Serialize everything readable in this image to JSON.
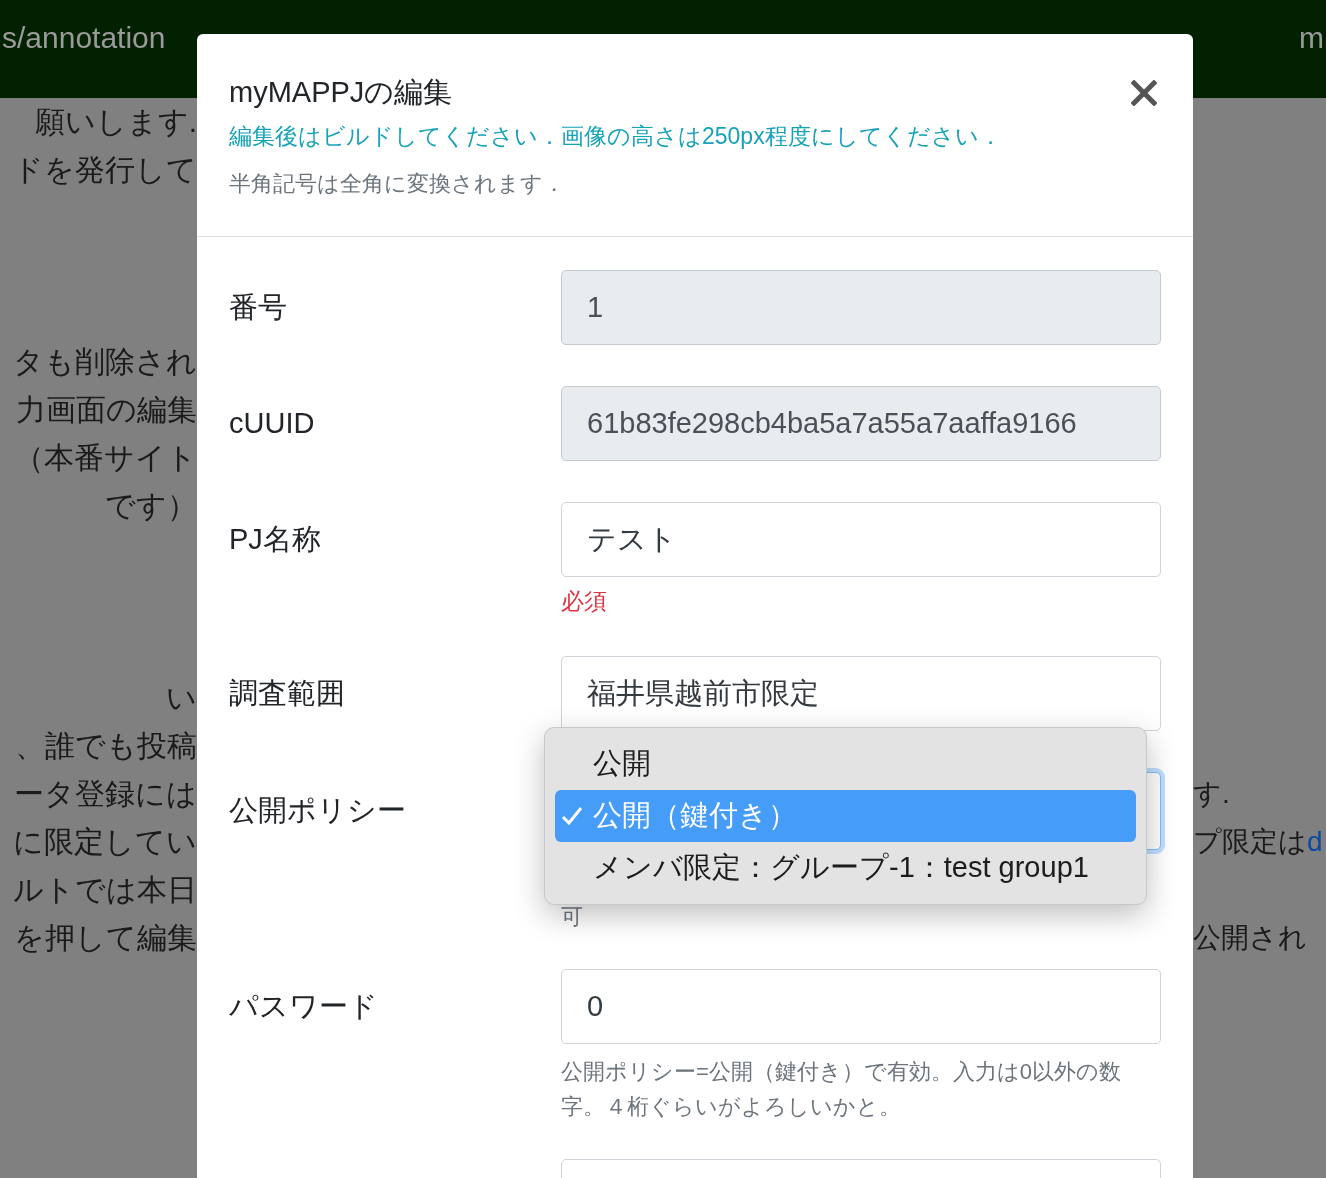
{
  "top_bar": {
    "left_text": "s/annotation",
    "right_text": "m"
  },
  "background": {
    "left_paragraphs": [
      [
        "願いします.",
        "ドを発行して"
      ],
      [
        "タも削除され",
        "力画面の編集",
        "（本番サイト",
        "です）"
      ],
      [
        "い",
        "、誰でも投稿",
        "ータ登録には",
        "に限定してい",
        "ルトでは本日",
        "を押して編集"
      ]
    ],
    "right_lines": [
      {
        "text": "す."
      },
      {
        "text": "プ限定は",
        "link": "d"
      },
      {
        "text": "公開され"
      }
    ]
  },
  "modal": {
    "title": "myMAPPJの編集",
    "notice": "編集後はビルドしてください．画像の高さは250px程度にしてください．",
    "note": "半角記号は全角に変換されます．",
    "fields": [
      {
        "kind": "text",
        "label": "番号",
        "value": "1",
        "disabled": true
      },
      {
        "kind": "text",
        "label": "cUUID",
        "value": "61b83fe298cb4ba5a7a55a7aaffa9166",
        "disabled": true
      },
      {
        "kind": "text",
        "label": "PJ名称",
        "value": "テスト",
        "disabled": false,
        "help": "必須",
        "help_error": true
      },
      {
        "kind": "text",
        "label": "調査範囲",
        "value": "福井県越前市限定",
        "disabled": false
      },
      {
        "kind": "select",
        "label": "公開ポリシー",
        "disabled": false,
        "help": "可",
        "help_error": false,
        "options": [
          {
            "label": "公開",
            "selected": false
          },
          {
            "label": "公開（鍵付き）",
            "selected": true
          },
          {
            "label": "メンバ限定：グループ-1：test group1",
            "selected": false
          }
        ]
      },
      {
        "kind": "text",
        "label": "パスワード",
        "value": "0",
        "disabled": false,
        "help": "公開ポリシー=公開（鍵付き）で有効。入力は0以外の数字。４桁ぐらいがよろしいかと。",
        "help_error": false
      },
      {
        "kind": "text",
        "disabled": false
      }
    ]
  }
}
